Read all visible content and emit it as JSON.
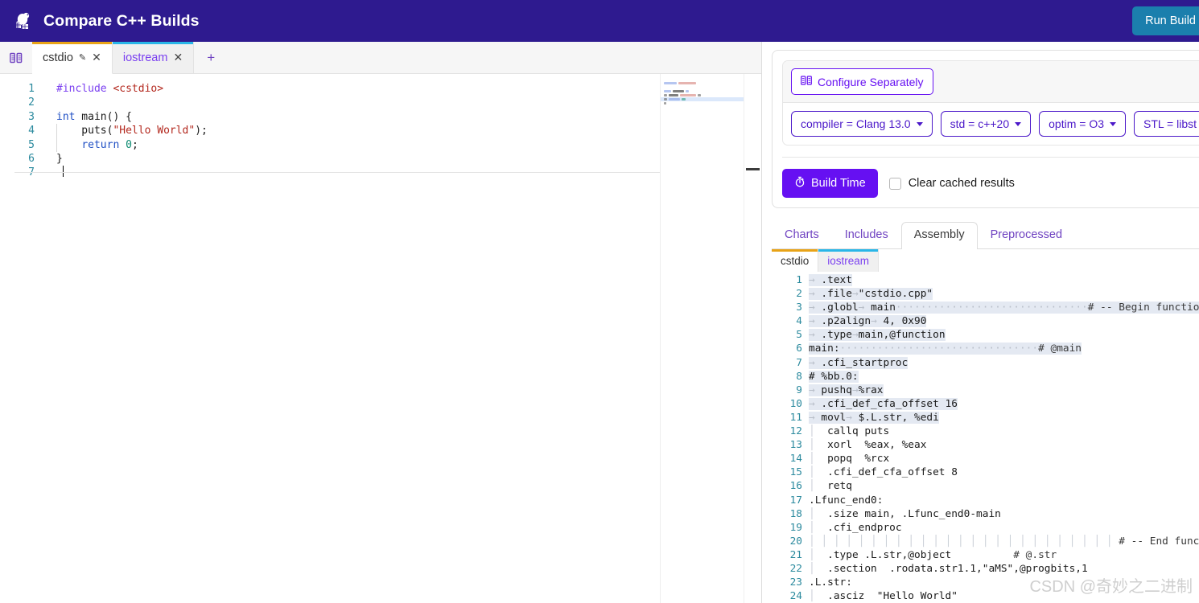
{
  "header": {
    "title": "Compare C++ Builds",
    "logo_icon": "beaver-logo-icon",
    "run_build_label": "Run Build",
    "bg_color": "#2e1a8f",
    "run_build_color": "#1b7fad"
  },
  "editor": {
    "split_icon": "split-view-icon",
    "new_tab_label": "+",
    "tabs": [
      {
        "label": "cstdio",
        "active": true,
        "accent": "#e8a317",
        "pencil_icon": "pencil-icon",
        "close_icon": "close-icon"
      },
      {
        "label": "iostream",
        "active": false,
        "accent": "#29b6e8",
        "close_icon": "close-icon"
      }
    ],
    "line_numbers": [
      "1",
      "2",
      "3",
      "4",
      "5",
      "6",
      "7"
    ],
    "code_lines": [
      [
        {
          "t": "#include ",
          "c": "pre"
        },
        {
          "t": "<cstdio>",
          "c": "inc"
        }
      ],
      [],
      [
        {
          "t": "int",
          "c": "kw"
        },
        {
          "t": " main() {",
          "c": "plain"
        }
      ],
      [
        {
          "t": "    puts(",
          "c": "plain"
        },
        {
          "t": "\"Hello World\"",
          "c": "str"
        },
        {
          "t": ");",
          "c": "plain"
        }
      ],
      [
        {
          "t": "    ",
          "c": "plain"
        },
        {
          "t": "return",
          "c": "kw"
        },
        {
          "t": " ",
          "c": "plain"
        },
        {
          "t": "0",
          "c": "num"
        },
        {
          "t": ";",
          "c": "plain"
        }
      ],
      [
        {
          "t": "}",
          "c": "plain"
        }
      ],
      []
    ]
  },
  "config": {
    "configure_separately_label": "Configure Separately",
    "configure_icon": "columns-icon",
    "options": [
      {
        "label": "compiler = Clang 13.0"
      },
      {
        "label": "std = c++20"
      },
      {
        "label": "optim = O3"
      },
      {
        "label": "STL = libst"
      }
    ],
    "build_time_label": "Build Time",
    "build_time_icon": "stopwatch-icon",
    "build_time_color": "#6610f2",
    "clear_cache_label": "Clear cached results",
    "clear_cache_checked": false
  },
  "results": {
    "tabs": [
      {
        "label": "Charts",
        "active": false
      },
      {
        "label": "Includes",
        "active": false
      },
      {
        "label": "Assembly",
        "active": true
      },
      {
        "label": "Preprocessed",
        "active": false
      }
    ],
    "asm_tabs": [
      {
        "label": "cstdio",
        "active": true,
        "accent": "#e8a317"
      },
      {
        "label": "iostream",
        "active": false,
        "accent": "#29b6e8"
      }
    ],
    "asm_line_numbers": [
      "1",
      "2",
      "3",
      "4",
      "5",
      "6",
      "7",
      "8",
      "9",
      "10",
      "11",
      "12",
      "13",
      "14",
      "15",
      "16",
      "17",
      "18",
      "19",
      "20",
      "21",
      "22",
      "23",
      "24"
    ],
    "asm_lines": [
      {
        "n": 1,
        "hl": true,
        "segs": [
          {
            "t": "→",
            "c": "ws"
          },
          {
            "t": " .text",
            "c": "plain"
          }
        ]
      },
      {
        "n": 2,
        "hl": true,
        "segs": [
          {
            "t": "→",
            "c": "ws"
          },
          {
            "t": " .file",
            "c": "plain"
          },
          {
            "t": "→",
            "c": "ws"
          },
          {
            "t": "\"cstdio.cpp\"",
            "c": "plain"
          }
        ]
      },
      {
        "n": 3,
        "hl": true,
        "segs": [
          {
            "t": "→",
            "c": "ws"
          },
          {
            "t": " .globl",
            "c": "plain"
          },
          {
            "t": "→",
            "c": "ws"
          },
          {
            "t": " main",
            "c": "plain"
          },
          {
            "t": "·······························",
            "c": "dot"
          },
          {
            "t": "# -- Begin function",
            "c": "comment"
          }
        ]
      },
      {
        "n": 4,
        "hl": true,
        "segs": [
          {
            "t": "→",
            "c": "ws"
          },
          {
            "t": " .p2align",
            "c": "plain"
          },
          {
            "t": "→",
            "c": "ws"
          },
          {
            "t": " 4, 0x90",
            "c": "plain"
          }
        ]
      },
      {
        "n": 5,
        "hl": true,
        "segs": [
          {
            "t": "→",
            "c": "ws"
          },
          {
            "t": " .type",
            "c": "plain"
          },
          {
            "t": "→",
            "c": "ws"
          },
          {
            "t": "main,@function",
            "c": "plain"
          }
        ]
      },
      {
        "n": 6,
        "hl": true,
        "segs": [
          {
            "t": "main:",
            "c": "plain"
          },
          {
            "t": "································",
            "c": "dot"
          },
          {
            "t": "# @main",
            "c": "comment"
          }
        ]
      },
      {
        "n": 7,
        "hl": true,
        "segs": [
          {
            "t": "→",
            "c": "ws"
          },
          {
            "t": " .cfi_startproc",
            "c": "plain"
          }
        ]
      },
      {
        "n": 8,
        "hl": true,
        "segs": [
          {
            "t": "# %bb.0:",
            "c": "plain"
          }
        ]
      },
      {
        "n": 9,
        "hl": true,
        "segs": [
          {
            "t": "→",
            "c": "ws"
          },
          {
            "t": " pushq",
            "c": "plain"
          },
          {
            "t": "→",
            "c": "ws"
          },
          {
            "t": "%rax",
            "c": "plain"
          }
        ]
      },
      {
        "n": 10,
        "hl": true,
        "segs": [
          {
            "t": "→",
            "c": "ws"
          },
          {
            "t": " .cfi_def_cfa_offset 16",
            "c": "plain"
          }
        ]
      },
      {
        "n": 11,
        "hl": true,
        "segs": [
          {
            "t": "→",
            "c": "ws"
          },
          {
            "t": " movl",
            "c": "plain"
          },
          {
            "t": "→",
            "c": "ws"
          },
          {
            "t": " $.L.str, %edi",
            "c": "plain"
          }
        ]
      },
      {
        "n": 12,
        "hl": false,
        "segs": [
          {
            "t": "│",
            "c": "bar"
          },
          {
            "t": "  callq puts",
            "c": "plain"
          }
        ]
      },
      {
        "n": 13,
        "hl": false,
        "segs": [
          {
            "t": "│",
            "c": "bar"
          },
          {
            "t": "  xorl  %eax, %eax",
            "c": "plain"
          }
        ]
      },
      {
        "n": 14,
        "hl": false,
        "segs": [
          {
            "t": "│",
            "c": "bar"
          },
          {
            "t": "  popq  %rcx",
            "c": "plain"
          }
        ]
      },
      {
        "n": 15,
        "hl": false,
        "segs": [
          {
            "t": "│",
            "c": "bar"
          },
          {
            "t": "  .cfi_def_cfa_offset 8",
            "c": "plain"
          }
        ]
      },
      {
        "n": 16,
        "hl": false,
        "segs": [
          {
            "t": "│",
            "c": "bar"
          },
          {
            "t": "  retq",
            "c": "plain"
          }
        ]
      },
      {
        "n": 17,
        "hl": false,
        "segs": [
          {
            "t": ".Lfunc_end0:",
            "c": "plain"
          }
        ]
      },
      {
        "n": 18,
        "hl": false,
        "segs": [
          {
            "t": "│",
            "c": "bar"
          },
          {
            "t": "  .size main, .Lfunc_end0-main",
            "c": "plain"
          }
        ]
      },
      {
        "n": 19,
        "hl": false,
        "segs": [
          {
            "t": "│",
            "c": "bar"
          },
          {
            "t": "  .cfi_endproc",
            "c": "plain"
          }
        ]
      },
      {
        "n": 20,
        "hl": false,
        "segs": [
          {
            "t": "│ │ │ │ │ │ │ │ │ │ │ │ │ │ │ │ │ │ │ │ │ │ │ │ │",
            "c": "bar"
          },
          {
            "t": " # -- End function",
            "c": "comment"
          }
        ]
      },
      {
        "n": 21,
        "hl": false,
        "segs": [
          {
            "t": "│",
            "c": "bar"
          },
          {
            "t": "  .type .L.str,@object          ",
            "c": "plain"
          },
          {
            "t": "# @.str",
            "c": "comment"
          }
        ]
      },
      {
        "n": 22,
        "hl": false,
        "segs": [
          {
            "t": "│",
            "c": "bar"
          },
          {
            "t": "  .section  .rodata.str1.1,\"aMS\",@progbits,1",
            "c": "plain"
          }
        ]
      },
      {
        "n": 23,
        "hl": false,
        "segs": [
          {
            "t": ".L.str:",
            "c": "plain"
          }
        ]
      },
      {
        "n": 24,
        "hl": false,
        "segs": [
          {
            "t": "│",
            "c": "bar"
          },
          {
            "t": "  .asciz  \"Hello World\"",
            "c": "plain"
          }
        ]
      }
    ]
  },
  "watermark": {
    "text": "CSDN @奇妙之二进制"
  }
}
